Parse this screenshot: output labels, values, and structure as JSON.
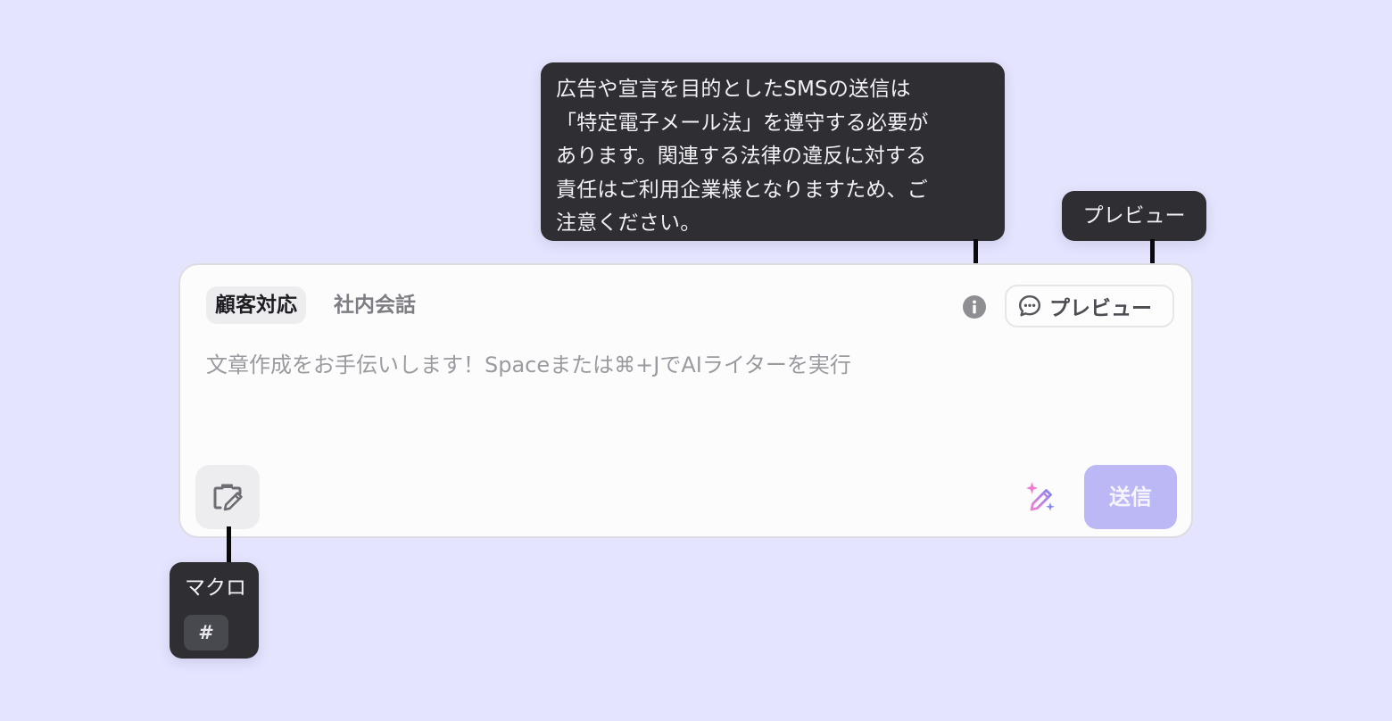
{
  "tooltips": {
    "sms_notice": {
      "lines": [
        "広告や宣言を目的としたSMSの送信は",
        "「特定電子メール法」を遵守する必要が",
        "あります。関連する法律の違反に対する",
        "責任はご利用企業様となりますため、ご",
        "注意ください。"
      ]
    },
    "preview": "プレビュー",
    "macro": {
      "label": "マクロ",
      "shortcut": "#"
    }
  },
  "composer": {
    "tabs": [
      {
        "label": "顧客対応",
        "active": true
      },
      {
        "label": "社内会話",
        "active": false
      }
    ],
    "info_icon": "info-icon",
    "preview_button": {
      "label": "プレビュー",
      "icon": "chat-bubble-icon"
    },
    "input": {
      "value": "",
      "placeholder": "文章作成をお手伝いします！Spaceまたは⌘+JでAIライターを実行"
    },
    "macro_button": {
      "icon": "macro-edit-icon"
    },
    "ai_writer_button": {
      "icon": "magic-pen-icon"
    },
    "send_button": {
      "label": "送信"
    }
  },
  "colors": {
    "page_background": "#e4e4fe",
    "tooltip_background": "#2e2e33",
    "send_button": "#bcb8f5",
    "ai_pen_gradient_start": "#f47fd2",
    "ai_pen_gradient_end": "#7f84f5"
  }
}
